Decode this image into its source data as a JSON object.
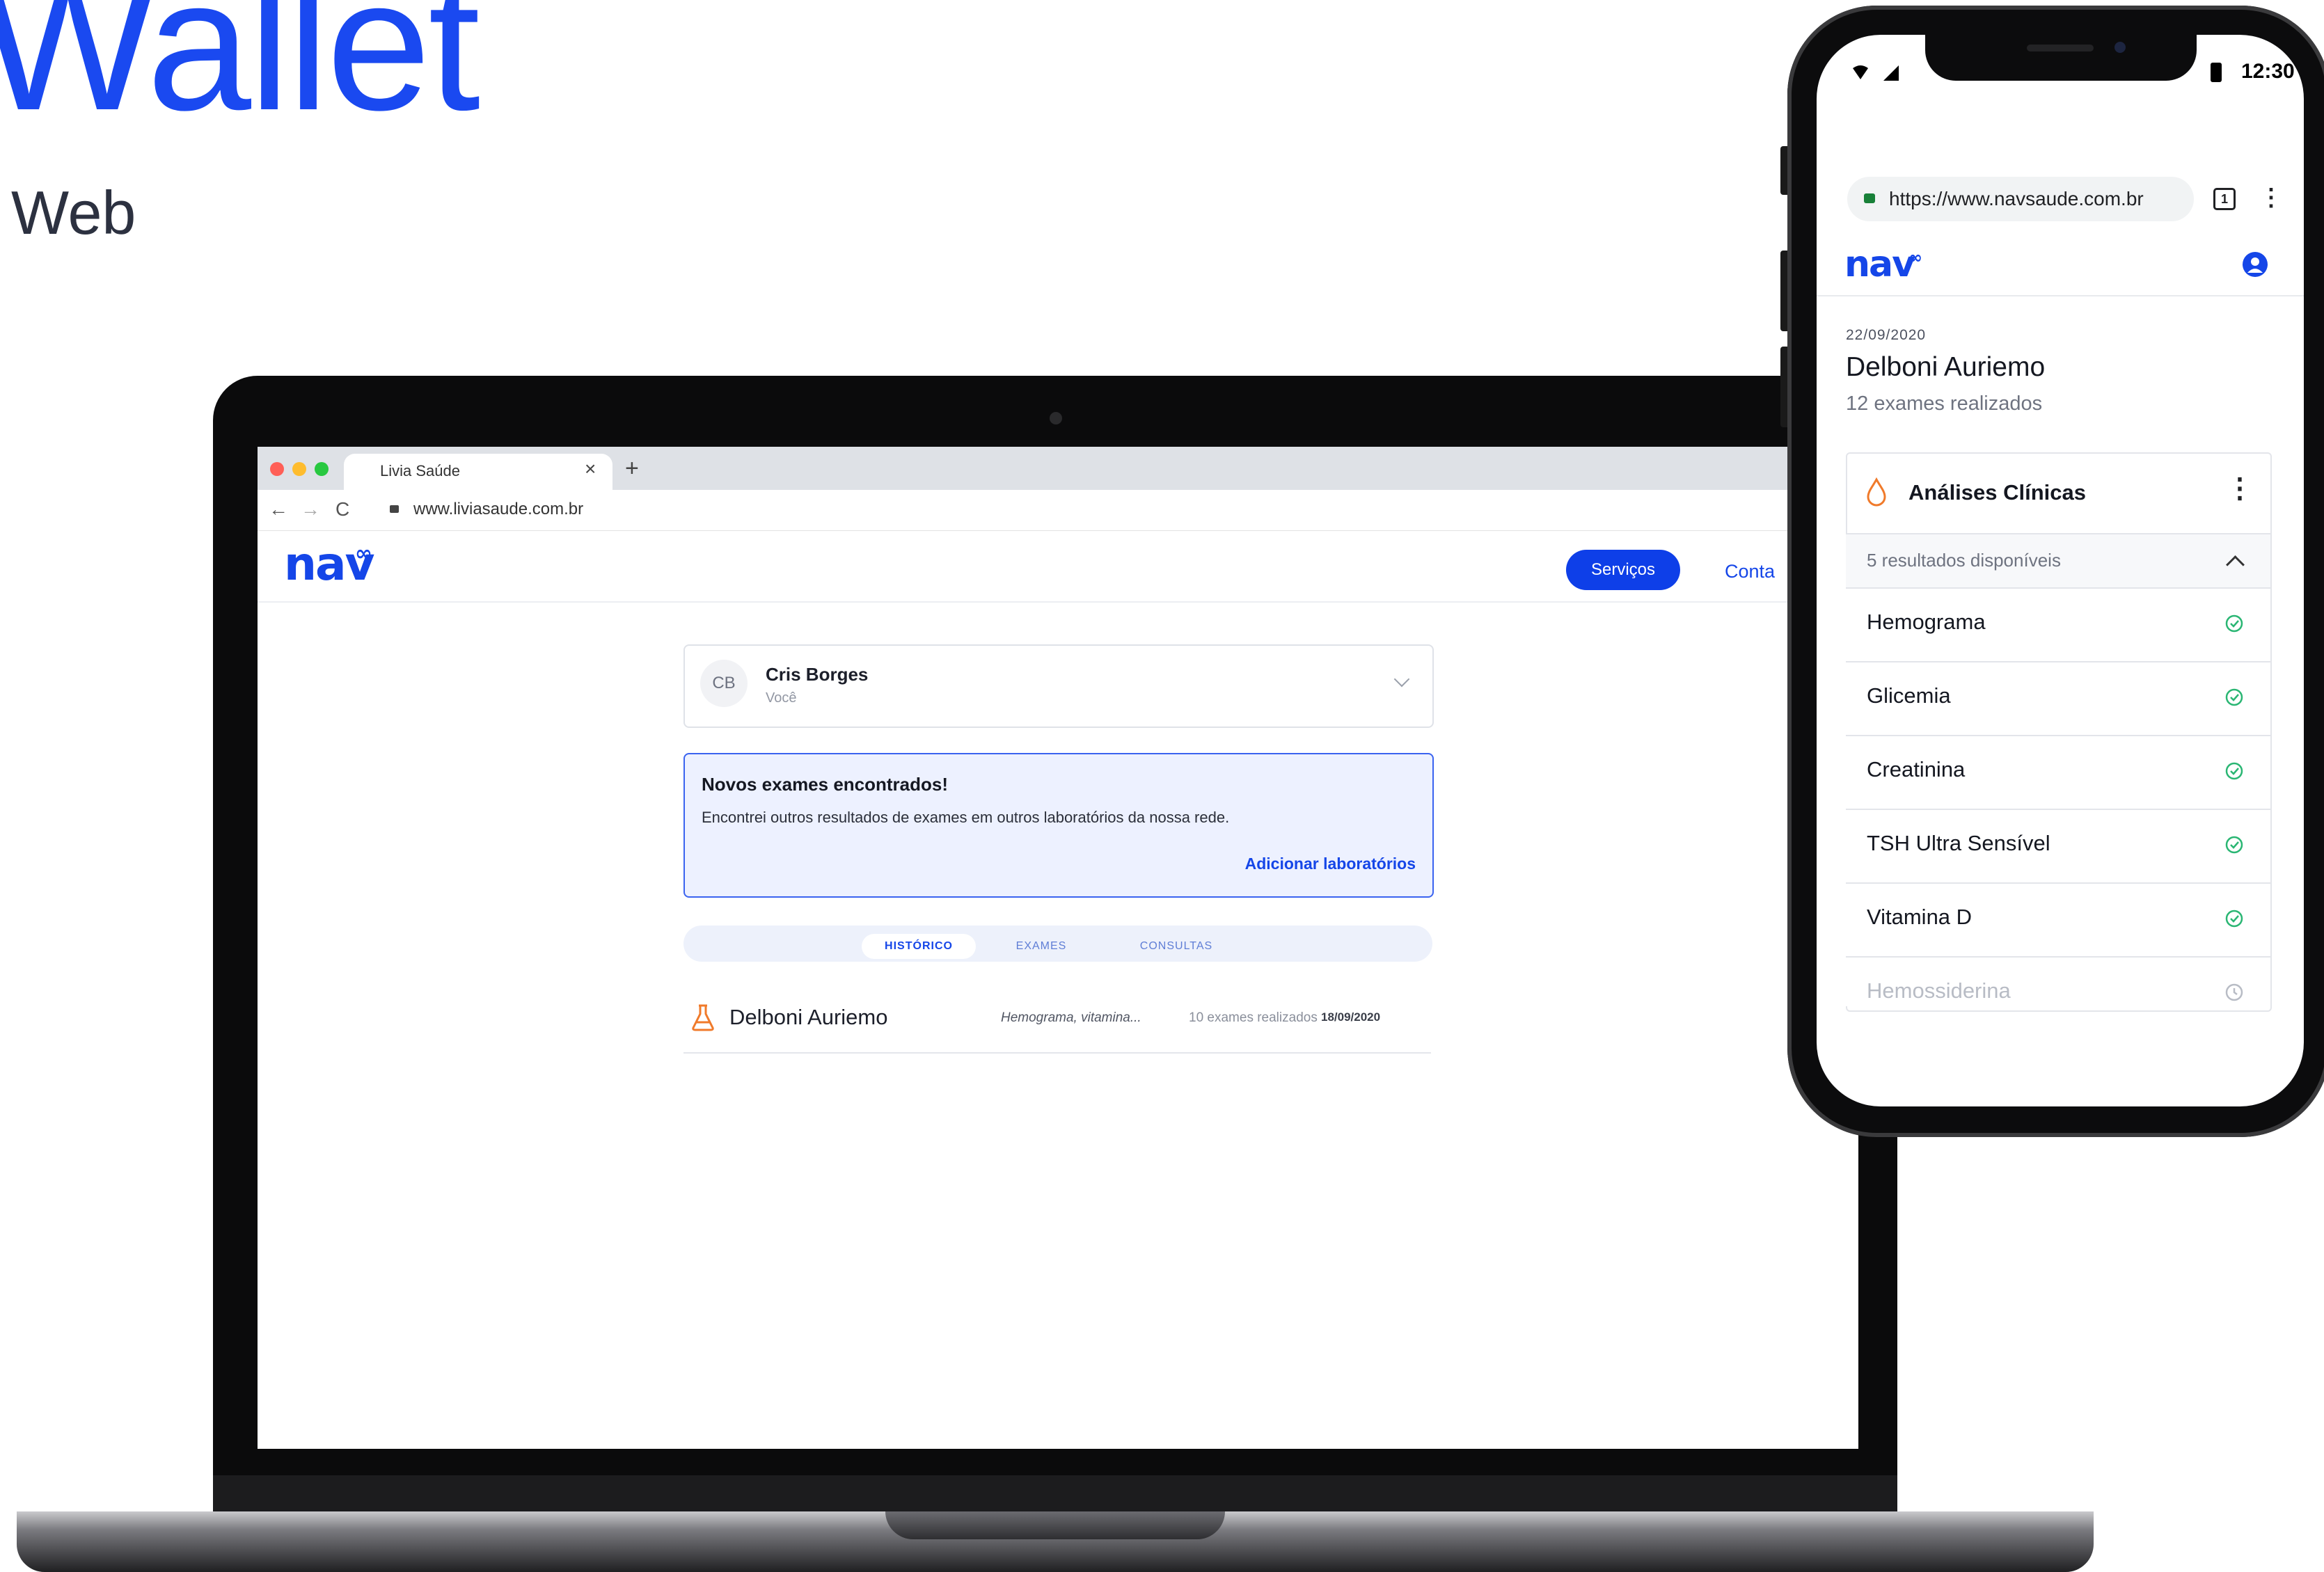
{
  "heading": {
    "title": "Wallet",
    "subtitle": "Web"
  },
  "desktop": {
    "browser": {
      "tab_title": "Livia Saúde",
      "tab_close": "×",
      "new_tab": "+",
      "back": "←",
      "forward": "→",
      "reload": "C",
      "url": "www.liviasaude.com.br"
    },
    "site": {
      "logo": "nav",
      "logo_mark": "∞",
      "header_button": "Serviços",
      "header_link": "Conta",
      "profile": {
        "initials": "CB",
        "name": "Cris Borges",
        "relation": "Você"
      },
      "notice": {
        "title": "Novos exames encontrados!",
        "text": "Encontrei outros resultados de exames em outros laboratórios da nossa rede.",
        "link": "Adicionar laboratórios"
      },
      "tabs": [
        "HISTÓRICO",
        "EXAMES",
        "CONSULTAS"
      ],
      "active_tab": "HISTÓRICO",
      "history": [
        {
          "lab": "Delboni Auriemo",
          "exams": "Hemograma, vitamina...",
          "count": "10 exames realizados",
          "date": "18/09/2020"
        }
      ]
    }
  },
  "mobile": {
    "status": {
      "time": "12:30"
    },
    "browser": {
      "url": "https://www.navsaude.com.br",
      "tabs_count": "1",
      "menu": "⋮"
    },
    "site": {
      "logo": "nav",
      "logo_mark": "∞",
      "date": "22/09/2020",
      "lab": "Delboni Auriemo",
      "summary": "12 exames realizados",
      "section": {
        "title": "Análises Clínicas",
        "menu": "⋮",
        "available": "5 resultados disponíveis",
        "items": [
          {
            "label": "Hemograma",
            "status": "done"
          },
          {
            "label": "Glicemia",
            "status": "done"
          },
          {
            "label": "Creatinina",
            "status": "done"
          },
          {
            "label": "TSH Ultra Sensível",
            "status": "done"
          },
          {
            "label": "Vitamina D",
            "status": "done"
          },
          {
            "label": "Hemossiderina",
            "status": "pending"
          }
        ]
      }
    }
  },
  "colors": {
    "brand_blue": "#1546e8",
    "success": "#2ab673",
    "pending": "#b8bcc5",
    "warning_orange": "#f07a2a"
  }
}
